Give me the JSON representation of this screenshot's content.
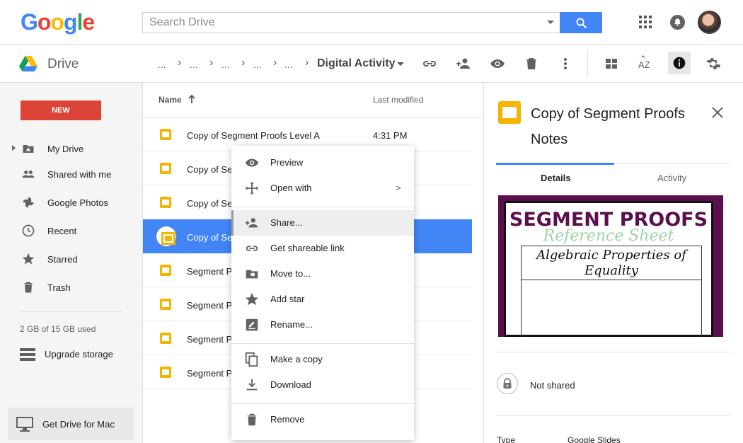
{
  "header": {
    "logo_letters": [
      {
        "ch": "G",
        "color": "#4285f4"
      },
      {
        "ch": "o",
        "color": "#ea4335"
      },
      {
        "ch": "o",
        "color": "#fbbc05"
      },
      {
        "ch": "g",
        "color": "#4285f4"
      },
      {
        "ch": "l",
        "color": "#34a853"
      },
      {
        "ch": "e",
        "color": "#ea4335"
      }
    ],
    "search_placeholder": "Search Drive",
    "icons": [
      "search-icon",
      "apps-icon",
      "notifications-icon",
      "avatar"
    ]
  },
  "drivebar": {
    "title": "Drive",
    "breadcrumbs": [
      "...",
      "...",
      "...",
      "...",
      "..."
    ],
    "current_folder": "Digital Activity",
    "toolbar_icons": [
      "link-icon",
      "add-person-icon",
      "eye-icon",
      "trash-icon",
      "more-vert-icon",
      "grid-view-icon",
      "sort-az-icon",
      "info-icon",
      "settings-icon"
    ]
  },
  "sidebar": {
    "new_label": "NEW",
    "items": [
      {
        "label": "My Drive",
        "icon": "my-drive-icon"
      },
      {
        "label": "Shared with me",
        "icon": "shared-icon"
      },
      {
        "label": "Google Photos",
        "icon": "photos-icon"
      },
      {
        "label": "Recent",
        "icon": "clock-icon"
      },
      {
        "label": "Starred",
        "icon": "star-icon"
      },
      {
        "label": "Trash",
        "icon": "trash-icon"
      }
    ],
    "storage_text": "2 GB of 15 GB used",
    "upgrade_label": "Upgrade storage",
    "get_drive_label": "Get Drive for Mac"
  },
  "filelist": {
    "col_name": "Name",
    "col_modified": "Last modified",
    "rows": [
      {
        "name": "Copy of Segment Proofs Level A",
        "modified": "4:31 PM"
      },
      {
        "name": "Copy of Se",
        "modified": ""
      },
      {
        "name": "Copy of Se",
        "modified": ""
      },
      {
        "name": "Copy of Se",
        "modified": "",
        "selected": true
      },
      {
        "name": "Segment P",
        "modified": ""
      },
      {
        "name": "Segment P",
        "modified": ""
      },
      {
        "name": "Segment P",
        "modified": ""
      },
      {
        "name": "Segment P",
        "modified": ""
      }
    ]
  },
  "context_menu": {
    "items": [
      {
        "label": "Preview",
        "icon": "eye-icon"
      },
      {
        "label": "Open with",
        "icon": "move-icon",
        "submenu": ">"
      },
      {
        "label": "Share...",
        "icon": "add-person-icon",
        "hover": true
      },
      {
        "label": "Get shareable link",
        "icon": "link-icon"
      },
      {
        "label": "Move to...",
        "icon": "folder-move-icon"
      },
      {
        "label": "Add star",
        "icon": "star-icon"
      },
      {
        "label": "Rename...",
        "icon": "rename-icon"
      },
      {
        "label": "Make a copy",
        "icon": "copy-icon"
      },
      {
        "label": "Download",
        "icon": "download-icon"
      },
      {
        "label": "Remove",
        "icon": "trash-icon"
      }
    ]
  },
  "details": {
    "title": "Copy of Segment Proofs Notes",
    "tab_details": "Details",
    "tab_activity": "Activity",
    "preview": {
      "heading": "SEGMENT PROOFS",
      "subheading": "Reference Sheet",
      "box_title": "Algebraic Properties of Equality"
    },
    "share_status": "Not shared",
    "type_key": "Type",
    "type_value": "Google Slides"
  },
  "colors": {
    "accent": "#4285f4",
    "new_button": "#db4437",
    "slides": "#f4b400",
    "preview_bg": "#5b0f4c"
  }
}
